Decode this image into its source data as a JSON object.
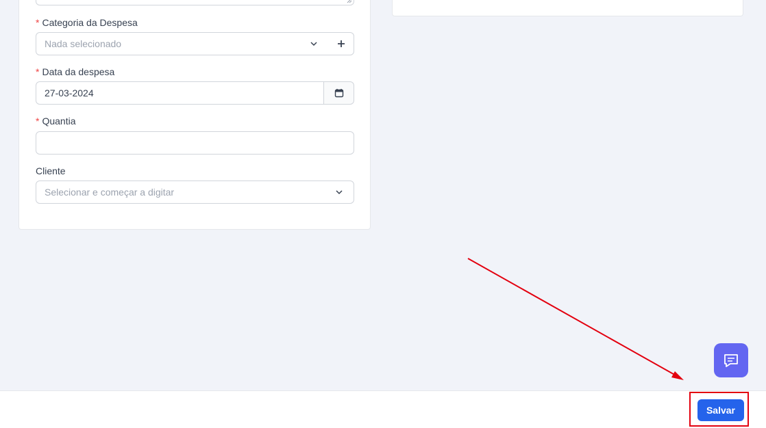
{
  "form": {
    "category": {
      "label": "Categoria da Despesa",
      "required_mark": "*",
      "placeholder": "Nada selecionado",
      "add_icon": "plus-icon",
      "dropdown_icon": "chevron-down-icon"
    },
    "date": {
      "label": "Data da despesa",
      "required_mark": "*",
      "value": "27-03-2024",
      "calendar_icon": "calendar-icon"
    },
    "amount": {
      "label": "Quantia",
      "required_mark": "*",
      "value": ""
    },
    "client": {
      "label": "Cliente",
      "placeholder": "Selecionar e começar a digitar",
      "dropdown_icon": "chevron-down-icon"
    }
  },
  "footer": {
    "save_label": "Salvar"
  },
  "chat": {
    "icon": "chat-icon"
  },
  "colors": {
    "primary": "#2563eb",
    "chat_button": "#6366f1",
    "required": "#ef4444",
    "annotation": "#e3000f",
    "background": "#f1f3f9"
  }
}
